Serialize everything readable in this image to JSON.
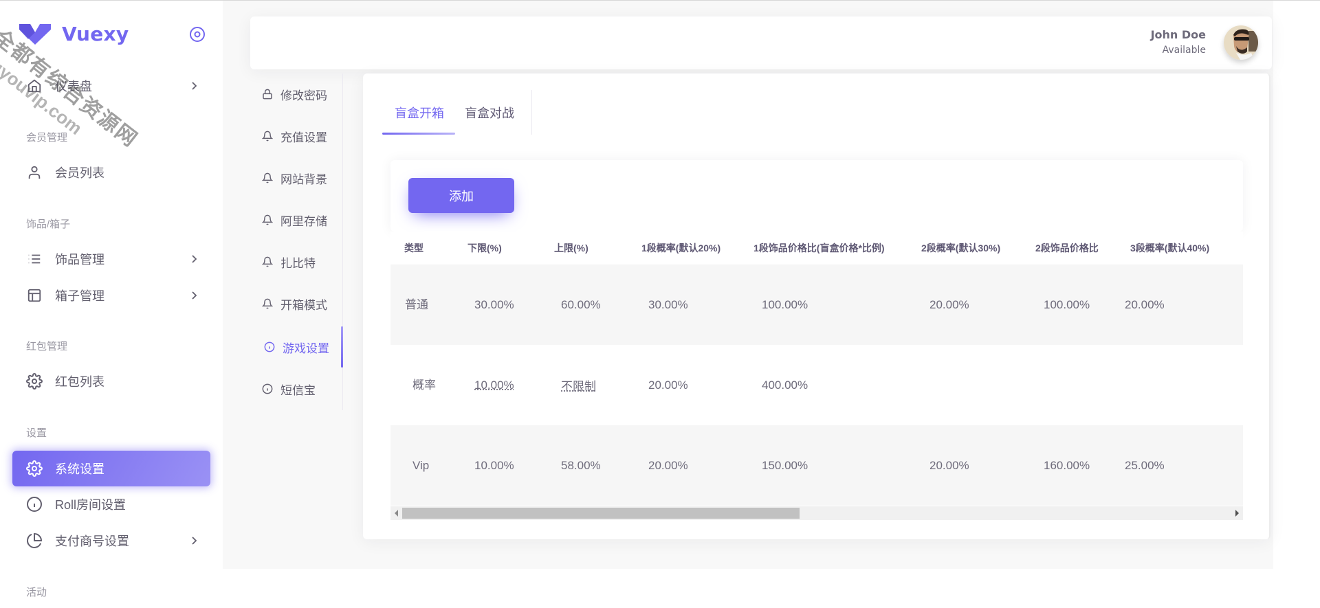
{
  "brand": {
    "name": "Vuexy",
    "color": "#7367f0"
  },
  "watermark": {
    "line1": "全都有综合资源网",
    "line2": "douyouvip.com"
  },
  "sidebar": {
    "items": [
      {
        "type": "item",
        "label": "仪表盘",
        "icon": "home-icon",
        "chevron": true
      },
      {
        "type": "header",
        "label": "会员管理"
      },
      {
        "type": "item",
        "label": "会员列表",
        "icon": "user-icon",
        "chevron": false
      },
      {
        "type": "header",
        "label": "饰品/箱子"
      },
      {
        "type": "item",
        "label": "饰品管理",
        "icon": "list-icon",
        "chevron": true
      },
      {
        "type": "item",
        "label": "箱子管理",
        "icon": "layout-icon",
        "chevron": true
      },
      {
        "type": "header",
        "label": "红包管理"
      },
      {
        "type": "item",
        "label": "红包列表",
        "icon": "gear-icon",
        "chevron": false
      },
      {
        "type": "header",
        "label": "设置"
      },
      {
        "type": "item",
        "label": "系统设置",
        "icon": "gear-icon",
        "chevron": false,
        "active": true
      },
      {
        "type": "item",
        "label": "Roll房间设置",
        "icon": "info-icon",
        "chevron": false
      },
      {
        "type": "item",
        "label": "支付商号设置",
        "icon": "pie-chart-icon",
        "chevron": true
      },
      {
        "type": "header",
        "label": "活动"
      }
    ]
  },
  "header": {
    "user_name": "John Doe",
    "user_status": "Available"
  },
  "subnav": {
    "items": [
      {
        "label": "修改密码",
        "icon": "lock-icon"
      },
      {
        "label": "充值设置",
        "icon": "bell-icon"
      },
      {
        "label": "网站背景",
        "icon": "bell-icon"
      },
      {
        "label": "阿里存储",
        "icon": "bell-icon"
      },
      {
        "label": "扎比特",
        "icon": "bell-icon"
      },
      {
        "label": "开箱模式",
        "icon": "bell-icon"
      },
      {
        "label": "游戏设置",
        "icon": "info-icon",
        "active": true
      },
      {
        "label": "短信宝",
        "icon": "info-icon"
      }
    ]
  },
  "tabs": [
    {
      "label": "盲盒开箱",
      "active": true
    },
    {
      "label": "盲盒对战",
      "active": false
    }
  ],
  "toolbar": {
    "add_label": "添加"
  },
  "table": {
    "columns": [
      "类型",
      "下限(%)",
      "上限(%)",
      "1段概率(默认20%)",
      "1段饰品价格比(盲盒价格*比例)",
      "2段概率(默认30%)",
      "2段饰品价格比",
      "3段概率(默认40%)"
    ],
    "rows": [
      [
        "普通",
        "30.00%",
        "60.00%",
        "30.00%",
        "100.00%",
        "20.00%",
        "100.00%",
        "20.00%"
      ],
      [
        "概率",
        "10.00%",
        "不限制",
        "20.00%",
        "400.00%",
        "",
        "",
        ""
      ],
      [
        "Vip",
        "10.00%",
        "58.00%",
        "20.00%",
        "150.00%",
        "20.00%",
        "160.00%",
        "25.00%"
      ]
    ]
  },
  "scroll": {
    "horizontal_position": 0
  }
}
